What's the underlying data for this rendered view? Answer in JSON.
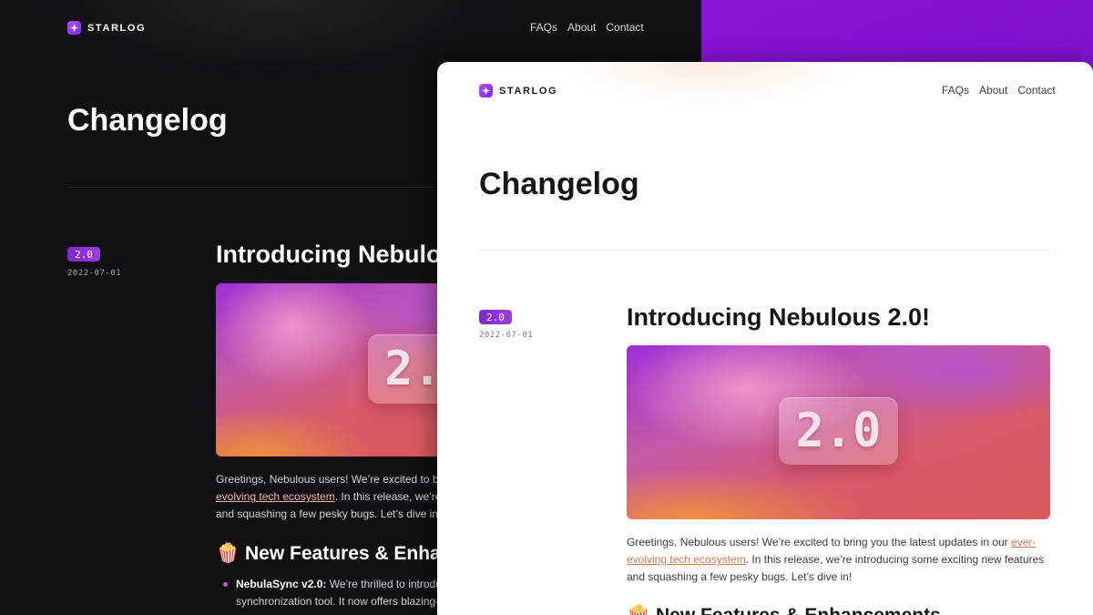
{
  "brand": {
    "name": "STARLOG",
    "logo_icon": "sparkle-icon",
    "accent": "#8a14d6"
  },
  "nav": [
    "FAQs",
    "About",
    "Contact"
  ],
  "page_title": "Changelog",
  "release": {
    "version": "2.0",
    "date": "2022-07-01",
    "title": "Introducing Nebulous 2.0!",
    "hero_text": "2.0",
    "intro_before": "Greetings, Nebulous users! We’re excited to bring you the latest updates in our ",
    "intro_link": "ever-evolving tech ecosystem",
    "intro_after": ". In this release, we’re introducing some exciting new features and squashing a few pesky bugs. Let’s dive in!",
    "section_heading_icon": "🍿",
    "section_heading": "New Features & Enhancements",
    "features": [
      {
        "name": "NebulaSync v2.0:",
        "text": " We’re thrilled to introduce the latest version of our cloud synchronization tool. It now offers blazing-fast"
      }
    ]
  }
}
